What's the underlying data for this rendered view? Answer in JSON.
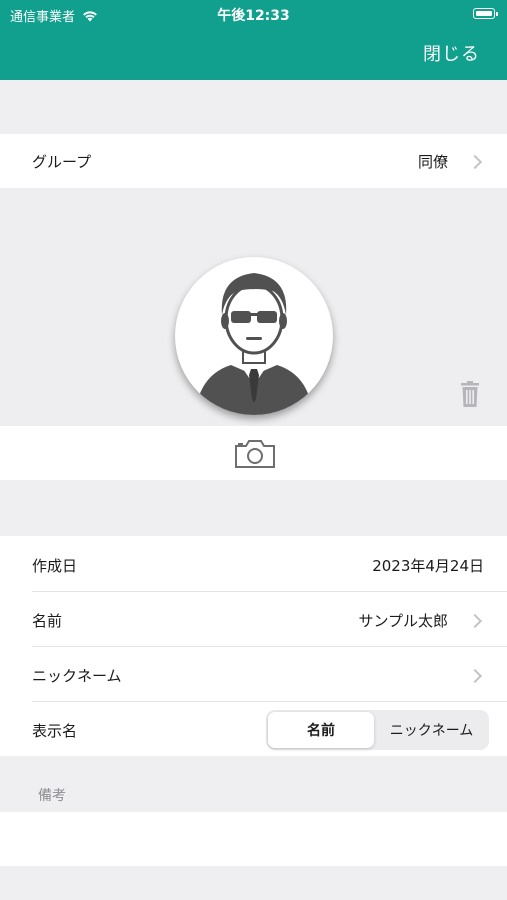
{
  "status_bar": {
    "carrier": "通信事業者",
    "time": "午後12:33"
  },
  "nav": {
    "close_label": "閉じる",
    "bar_color": "#10a08d"
  },
  "group_row": {
    "label": "グループ",
    "value": "同僚"
  },
  "photo": {
    "avatar_icon": "person-avatar-icon",
    "delete_icon": "trash-icon",
    "camera_icon": "camera-icon"
  },
  "details": {
    "created": {
      "label": "作成日",
      "value": "2023年4月24日"
    },
    "name": {
      "label": "名前",
      "value": "サンプル太郎"
    },
    "nickname": {
      "label": "ニックネーム",
      "value": ""
    },
    "display_name": {
      "label": "表示名",
      "options": [
        "名前",
        "ニックネーム"
      ],
      "selected": "名前"
    }
  },
  "notes": {
    "header": "備考",
    "value": ""
  }
}
